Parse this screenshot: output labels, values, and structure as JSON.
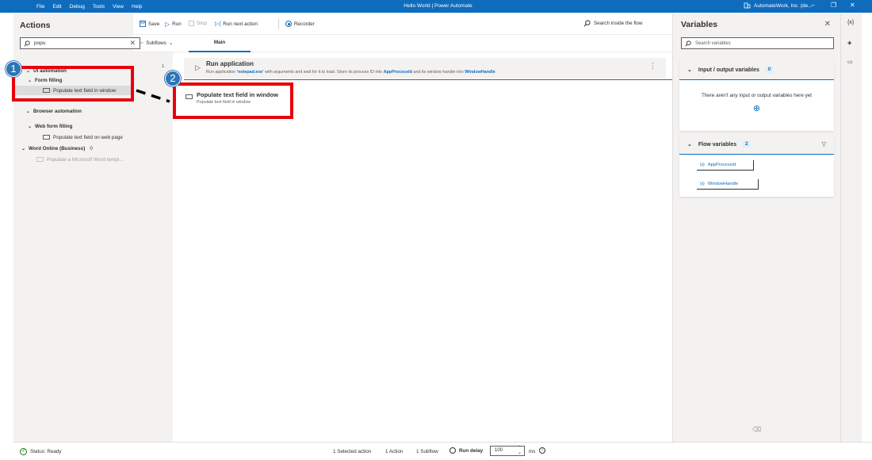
{
  "titlebar": {
    "menu": [
      "File",
      "Edit",
      "Debug",
      "Tools",
      "View",
      "Help"
    ],
    "title": "Hello World | Power Automate",
    "account": "AutomateWork, Inc. (de..."
  },
  "actions_pane": {
    "header": "Actions",
    "search_value": "popu",
    "tree": {
      "group1_partial": "UI automation",
      "form_filling": "Form filling",
      "populate_window": "Populate text field in window",
      "group2_partial": "Browser automation",
      "web_form_filling": "Web form filling",
      "populate_web": "Populate text field on web page",
      "word_online": "Word Online (Business)",
      "populate_word": "Populate a Microsoft Word templ..."
    }
  },
  "toolbar": {
    "save": "Save",
    "run": "Run",
    "stop": "Stop",
    "run_next": "Run next action",
    "recorder": "Recorder",
    "search": "Search inside the flow"
  },
  "tabs": {
    "subflows": "Subflows",
    "main": "Main"
  },
  "flow": {
    "steps": [
      {
        "number": "1",
        "name": "Run application",
        "desc_pre": "Run application ",
        "desc_app": "'notepad.exe'",
        "desc_mid": " with arguments  and wait for it to load. Store its process ID into ",
        "var1": "AppProcessId",
        "desc_mid2": "  and its window handle into ",
        "var2": "WindowHandle"
      }
    ],
    "dragging": {
      "name": "Populate text field in window",
      "sub": "Populate text field in window"
    }
  },
  "annotations": {
    "badge1": "1",
    "badge2": "2",
    "color": "#e8000b",
    "badge_color": "#2e75b6"
  },
  "variables_pane": {
    "header": "Variables",
    "search_placeholder": "Search variables",
    "io_header": "Input / output variables",
    "io_count": "0",
    "io_empty": "There aren't any input or output variables here yet",
    "flow_header": "Flow variables",
    "flow_count": "2",
    "flow_vars": [
      "AppProcessId",
      "WindowHandle"
    ]
  },
  "status": {
    "ready": "Status: Ready",
    "selected": "1 Selected action",
    "actions": "1 Action",
    "subflows": "1 Subflow",
    "run_delay_label": "Run delay",
    "run_delay_value": "100",
    "unit": "ms"
  },
  "colors": {
    "accent": "#0f6cbd",
    "pane": "#f3f2f1"
  }
}
